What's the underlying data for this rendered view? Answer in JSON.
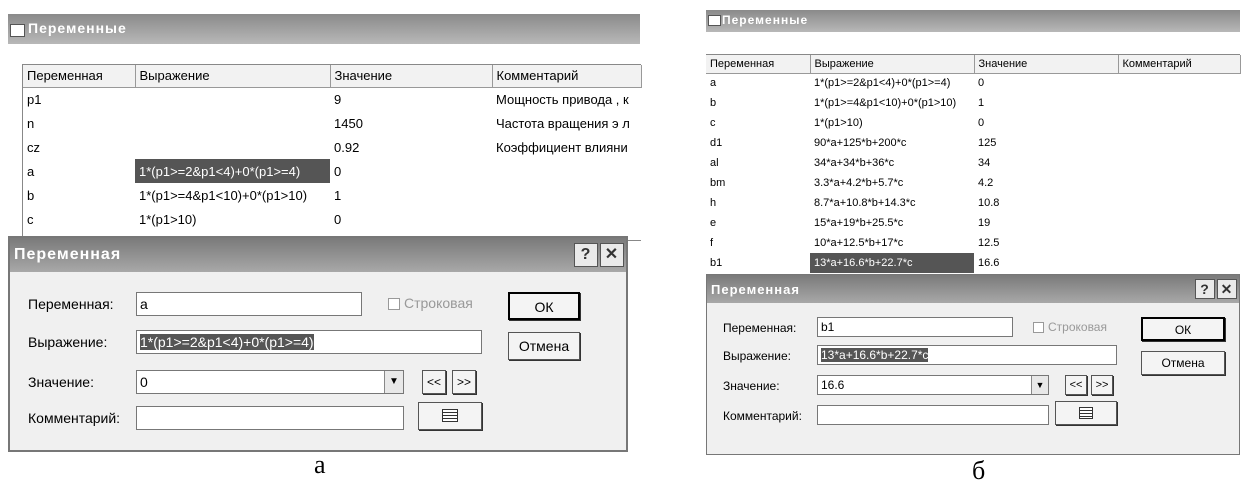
{
  "panel_a": {
    "window_title": "Переменные",
    "columns": [
      "Переменная",
      "Выражение",
      "Значение",
      "Комментарий"
    ],
    "rows": [
      [
        "p1",
        "",
        "9",
        "Мощность привода , к"
      ],
      [
        "n",
        "",
        "1450",
        "Частота вращения э л"
      ],
      [
        "cz",
        "",
        "0.92",
        "Коэффициент влияни"
      ],
      [
        "a",
        "1*(p1>=2&p1<4)+0*(p1>=4)",
        "0",
        ""
      ],
      [
        "b",
        "1*(p1>=4&p1<10)+0*(p1>10)",
        "1",
        ""
      ],
      [
        "c",
        "1*(p1>10)",
        "0",
        ""
      ]
    ],
    "dialog": {
      "title": "Переменная",
      "help_label": "?",
      "close_label": "✕",
      "variable_label": "Переменная:",
      "variable_value": "a",
      "string_checkbox_label": "Строковая",
      "ok_label": "ОК",
      "cancel_label": "Отмена",
      "expression_label": "Выражение:",
      "expression_value": "1*(p1>=2&p1<4)+0*(p1>=4)",
      "value_label": "Значение:",
      "value_value": "0",
      "prev_label": "<<",
      "next_label": ">>",
      "comment_label": "Комментарий:",
      "comment_value": ""
    },
    "caption": "а"
  },
  "panel_b": {
    "window_title": "Переменные",
    "columns": [
      "Переменная",
      "Выражение",
      "Значение",
      "Комментарий"
    ],
    "rows": [
      [
        "a",
        "1*(p1>=2&p1<4)+0*(p1>=4)",
        "0",
        ""
      ],
      [
        "b",
        "1*(p1>=4&p1<10)+0*(p1>10)",
        "1",
        ""
      ],
      [
        "c",
        "1*(p1>10)",
        "0",
        ""
      ],
      [
        "d1",
        "90*a+125*b+200*c",
        "125",
        ""
      ],
      [
        "al",
        "34*a+34*b+36*c",
        "34",
        ""
      ],
      [
        "bm",
        "3.3*a+4.2*b+5.7*c",
        "4.2",
        ""
      ],
      [
        "h",
        "8.7*a+10.8*b+14.3*c",
        "10.8",
        ""
      ],
      [
        "e",
        "15*a+19*b+25.5*c",
        "19",
        ""
      ],
      [
        "f",
        "10*a+12.5*b+17*c",
        "12.5",
        ""
      ],
      [
        "b1",
        "13*a+16.6*b+22.7*c",
        "16.6",
        ""
      ]
    ],
    "dialog": {
      "title": "Переменная",
      "help_label": "?",
      "close_label": "✕",
      "variable_label": "Переменная:",
      "variable_value": "b1",
      "string_checkbox_label": "Строковая",
      "ok_label": "ОК",
      "cancel_label": "Отмена",
      "expression_label": "Выражение:",
      "expression_value": "13*a+16.6*b+22.7*c",
      "value_label": "Значение:",
      "value_value": "16.6",
      "prev_label": "<<",
      "next_label": ">>",
      "comment_label": "Комментарий:",
      "comment_value": ""
    },
    "caption": "б"
  }
}
